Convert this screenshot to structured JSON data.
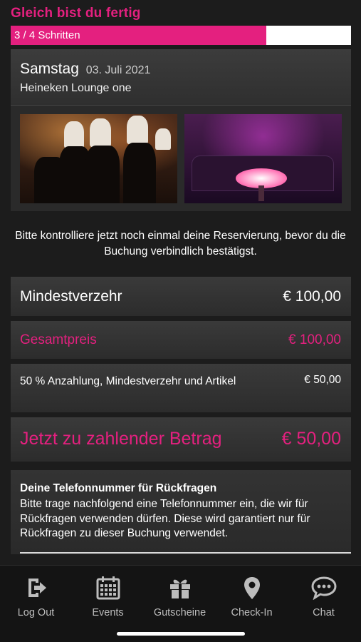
{
  "header": {
    "title": "Gleich bist du fertig"
  },
  "progress": {
    "label": "3 / 4 Schritten",
    "step": 3,
    "total": 4,
    "fraction": 0.75,
    "fill_color": "#e4207f"
  },
  "event": {
    "day": "Samstag",
    "date": "03. Juli 2021",
    "venue": "Heineken Lounge one"
  },
  "intro": {
    "text": "Bitte kontrolliere jetzt noch einmal deine Reservierung, bevor du die Buchung verbindlich bestätigst."
  },
  "summary": {
    "minimum": {
      "label": "Mindestverzehr",
      "value": "€ 100,00"
    },
    "total": {
      "label": "Gesamtpreis",
      "value": "€ 100,00"
    },
    "deposit": {
      "label": "50 %  Anzahlung, Mindestverzehr und Artikel",
      "value": "€ 50,00"
    },
    "due": {
      "label": "Jetzt zu zahlender Betrag",
      "value": "€ 50,00"
    }
  },
  "phone": {
    "heading": "Deine Telefonnummer für Rückfragen",
    "text": "Bitte trage nachfolgend eine Telefonnummer ein, die wir für Rückfragen verwenden dürfen. Diese wird garantiert nur für Rückfragen zu dieser Buchung verwendet."
  },
  "tabbar": {
    "items": [
      {
        "label": "Log Out",
        "icon": "logout-icon"
      },
      {
        "label": "Events",
        "icon": "calendar-icon"
      },
      {
        "label": "Gutscheine",
        "icon": "gift-icon"
      },
      {
        "label": "Check-In",
        "icon": "map-pin-icon"
      },
      {
        "label": "Chat",
        "icon": "chat-bubble-icon"
      }
    ]
  },
  "colors": {
    "accent": "#e4207f",
    "background": "#1c1c1c"
  }
}
